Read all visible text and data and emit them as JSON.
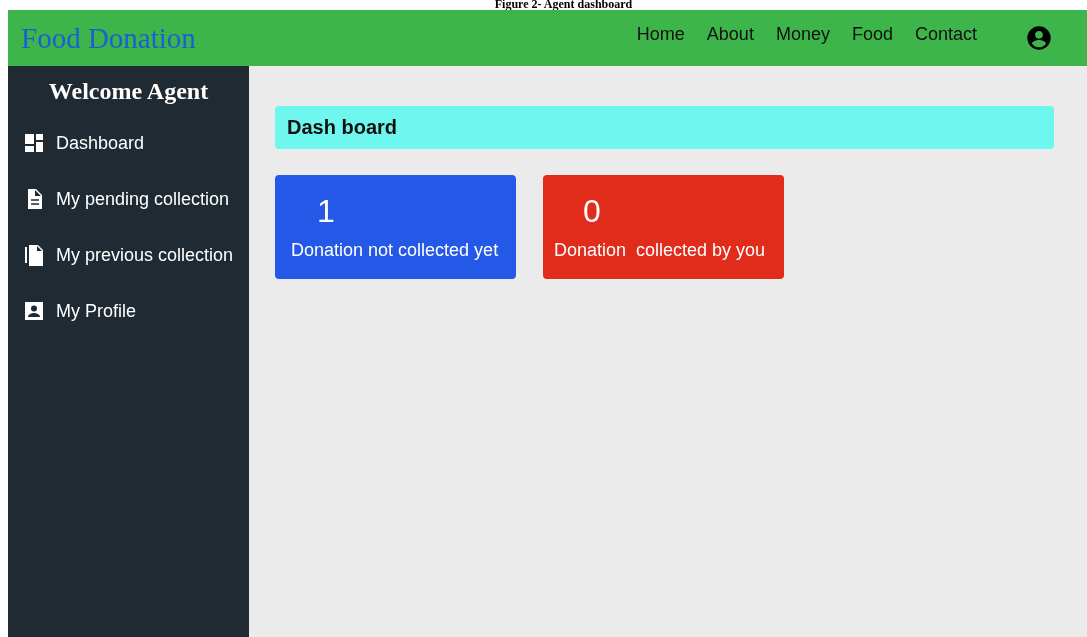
{
  "caption": "Figure 2- Agent dashboard",
  "navbar": {
    "brand": "Food Donation",
    "links": [
      "Home",
      "About",
      "Money",
      "Food",
      "Contact"
    ]
  },
  "sidebar": {
    "title": "Welcome Agent",
    "items": [
      {
        "label": "Dashboard"
      },
      {
        "label": "My pending collection"
      },
      {
        "label": "My previous collection"
      },
      {
        "label": "My Profile"
      }
    ]
  },
  "header": "Dash board",
  "cards": [
    {
      "count": "1",
      "label": "Donation not collected yet",
      "color": "#2459e8"
    },
    {
      "count": "0",
      "label": "Donation  collected by you",
      "color": "#e12b1b"
    }
  ]
}
